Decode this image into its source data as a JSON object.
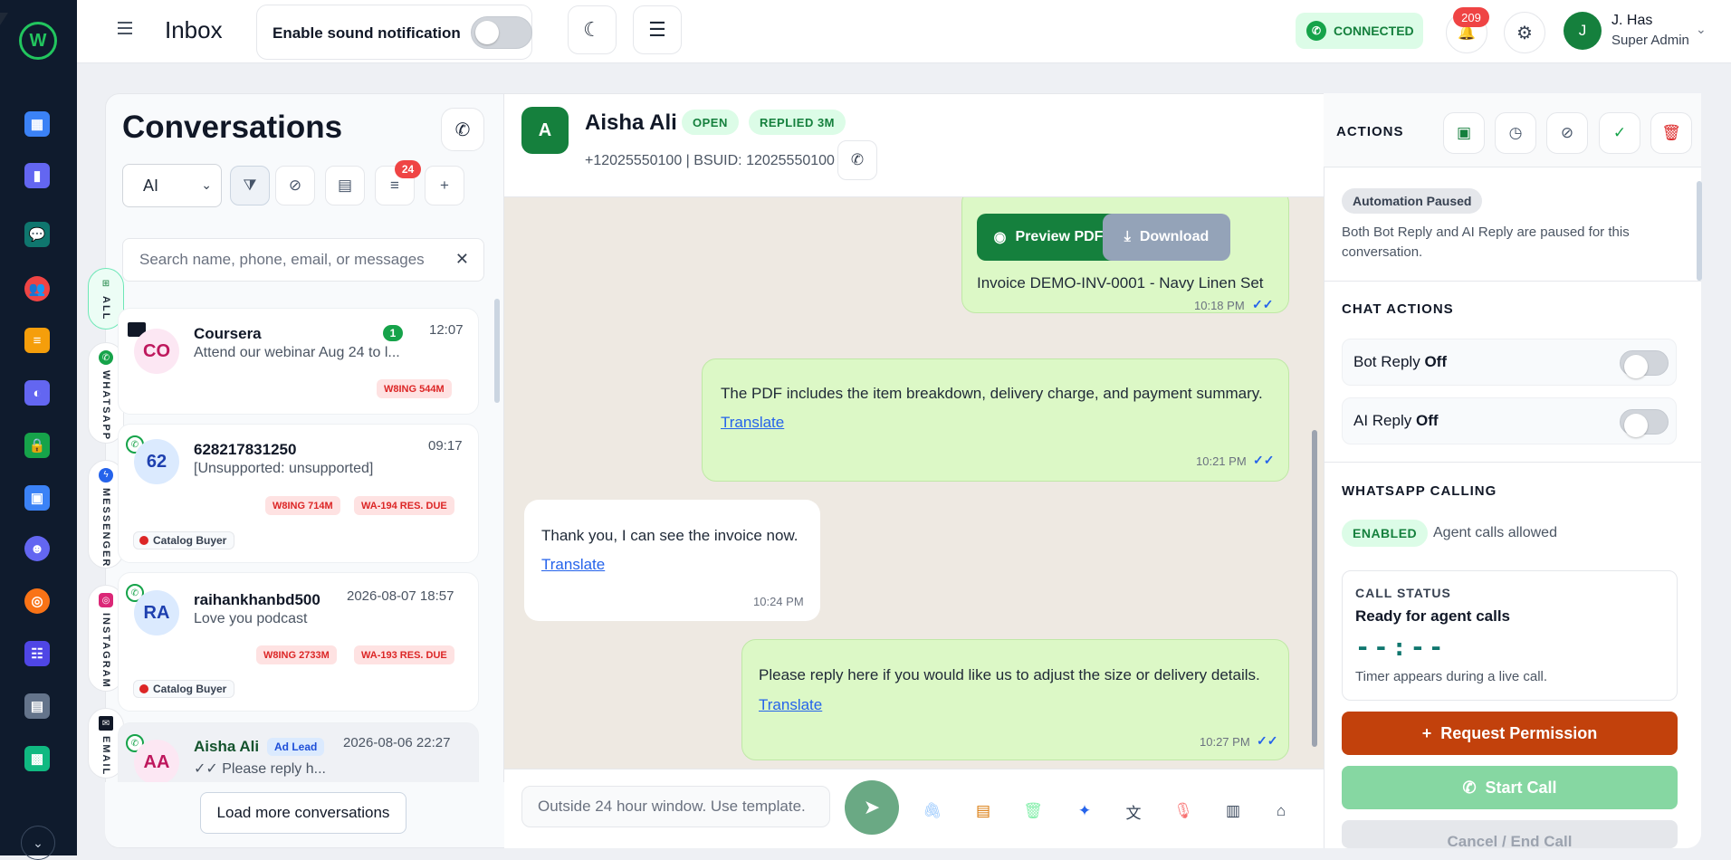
{
  "app": {
    "logo_letter": "W",
    "rail_icons": [
      "dashboard-icon",
      "analytics-icon",
      "chat-icon",
      "contacts-icon",
      "document-icon",
      "broadcast-icon",
      "lock-icon",
      "calendar-icon",
      "bot-icon",
      "target-icon",
      "forms-icon",
      "invoice-icon",
      "store-icon"
    ],
    "rail_expand": "⌄"
  },
  "topbar": {
    "menu_icon": "hamburger-icon",
    "title": "Inbox",
    "sound_label": "Enable sound notification",
    "sound_enabled": false,
    "moon_glyph": "☾",
    "tasks_glyph": "☰",
    "connection_status": "CONNECTED",
    "notification_count": "209",
    "bell_glyph": "🔔",
    "gear_glyph": "⚙",
    "user": {
      "initial": "J",
      "name": "J. Has",
      "role": "Super Admin"
    },
    "colors": {
      "brand_green": "#15803d",
      "badge_red": "#ef4444"
    }
  },
  "conversations": {
    "title": "Conversations",
    "phone_glyph": "✆",
    "filter_value": "AI",
    "controls": [
      "filter-icon",
      "block-icon",
      "document-icon",
      "sort-icon",
      "add-icon"
    ],
    "sort_badge": "24",
    "search_placeholder": "Search name, phone, email, or messages",
    "search_clear": "✕",
    "channel_tabs": [
      {
        "label": "ALL",
        "selected": true
      },
      {
        "label": "WHATSAPP",
        "selected": false
      },
      {
        "label": "MESSENGER",
        "selected": false
      },
      {
        "label": "INSTAGRAM",
        "selected": false
      },
      {
        "label": "EMAIL",
        "selected": false
      }
    ],
    "items": [
      {
        "initials": "CO",
        "name": "Coursera",
        "preview": "Attend our webinar Aug 24 to l...",
        "time": "12:07",
        "unread": "1",
        "tags": [
          "W8ING 544M"
        ],
        "buyer": ""
      },
      {
        "initials": "62",
        "name": "628217831250",
        "preview": "[Unsupported: unsupported]",
        "time": "09:17",
        "unread": "",
        "tags": [
          "W8ING 714M",
          "WA-194 RES. DUE"
        ],
        "buyer": "Catalog Buyer"
      },
      {
        "initials": "RA",
        "name": "raihankhanbd500",
        "preview": "Love you podcast",
        "time": "2026-08-07 18:57",
        "unread": "",
        "tags": [
          "W8ING 2733M",
          "WA-193 RES. DUE"
        ],
        "buyer": "Catalog Buyer"
      },
      {
        "initials": "AA",
        "name": "Aisha Ali",
        "badge": "Ad Lead",
        "preview": "✓✓ Please reply h...",
        "time": "2026-08-06 22:27",
        "unread": "",
        "tags": [],
        "buyer": ""
      }
    ],
    "load_more": "Load more conversations"
  },
  "chat": {
    "avatar": "A",
    "name": "Aisha Ali",
    "status": "OPEN",
    "replied": "REPLIED 3M",
    "phone_info": "+12025550100 | BSUID: 12025550100",
    "call_glyph": "✆",
    "messages": [
      {
        "dir": "out",
        "preview_pdf": "Preview PDF",
        "download": "Download",
        "text": "Invoice DEMO-INV-0001 - Navy Linen Set",
        "time": "10:18 PM"
      },
      {
        "dir": "out",
        "text": "The PDF includes the item breakdown, delivery charge, and payment summary.",
        "translate": "Translate",
        "time": "10:21 PM"
      },
      {
        "dir": "in",
        "text": "Thank you, I can see the invoice now.",
        "translate": "Translate",
        "time": "10:24 PM"
      },
      {
        "dir": "out",
        "text": "Please reply here if you would like us to adjust the size or delivery details.",
        "translate": "Translate",
        "time": "10:27 PM"
      }
    ],
    "ticks": "✓✓",
    "composer_placeholder": "Outside 24 hour window. Use template.",
    "send_glyph": "➤",
    "tools": [
      "attach-icon",
      "template-icon",
      "trash-icon",
      "ai-sparkle-icon",
      "translate-icon",
      "mic-icon",
      "note-icon",
      "tag-icon"
    ]
  },
  "actions": {
    "title": "ACTIONS",
    "header_buttons": [
      "contact-card-icon",
      "clock-icon",
      "block-icon",
      "check-circle-icon",
      "delete-icon"
    ],
    "automation_badge": "Automation Paused",
    "automation_desc": "Both Bot Reply and AI Reply are paused for this conversation.",
    "chat_actions_title": "CHAT ACTIONS",
    "bot_reply": {
      "label": "Bot Reply",
      "state": "Off"
    },
    "ai_reply": {
      "label": "AI Reply",
      "state": "Off"
    },
    "calling_title": "WHATSAPP CALLING",
    "calling_status": "ENABLED",
    "calling_note": "Agent calls allowed",
    "call_status_label": "CALL STATUS",
    "call_status_value": "Ready for agent calls",
    "timer": "--:--",
    "timer_hint": "Timer appears during a live call.",
    "request_permission": "Request Permission",
    "start_call": "Start Call",
    "end_call": "Cancel / End Call"
  }
}
